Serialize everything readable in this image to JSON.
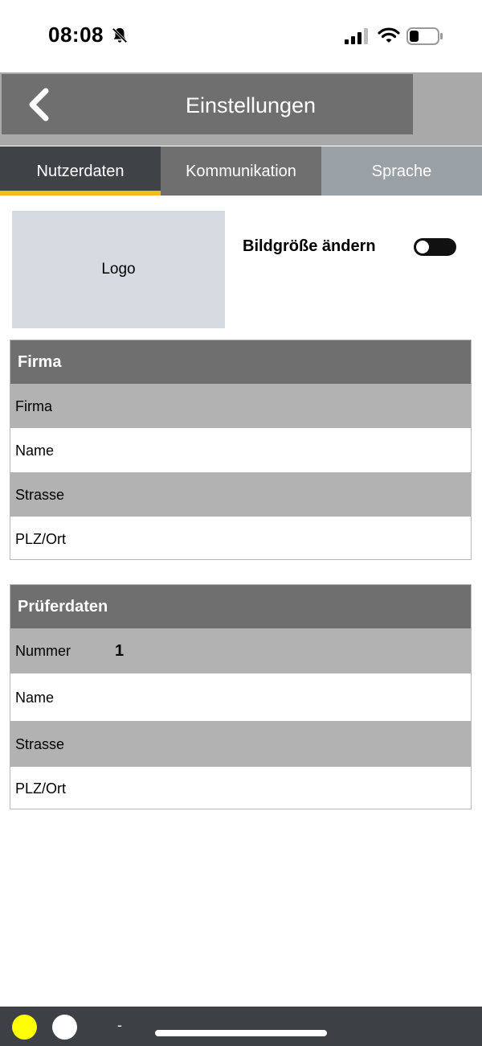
{
  "status_bar": {
    "time": "08:08",
    "icons": [
      "bell-slash-icon",
      "cellular-signal-icon",
      "wifi-icon",
      "battery-icon"
    ]
  },
  "header": {
    "title": "Einstellungen",
    "back_icon": "chevron-left-icon"
  },
  "tabs": [
    {
      "label": "Nutzerdaten",
      "active": true
    },
    {
      "label": "Kommunikation",
      "active": false
    },
    {
      "label": "Sprache",
      "active": false
    }
  ],
  "logo": {
    "label": "Logo"
  },
  "image_resize": {
    "label": "Bildgröße ändern",
    "enabled": false
  },
  "company_section": {
    "title": "Firma",
    "rows": [
      {
        "label": "Firma",
        "value": ""
      },
      {
        "label": "Name",
        "value": ""
      },
      {
        "label": "Strasse",
        "value": ""
      },
      {
        "label": "PLZ/Ort",
        "value": ""
      }
    ]
  },
  "inspector_section": {
    "title": "Prüferdaten",
    "rows": [
      {
        "label": "Nummer",
        "value": "1"
      },
      {
        "label": "Name",
        "value": ""
      },
      {
        "label": "Strasse",
        "value": ""
      },
      {
        "label": "PLZ/Ort",
        "value": ""
      }
    ]
  },
  "bottom_bar": {
    "dash": "-"
  },
  "colors": {
    "header_bg": "#6f6f6f",
    "active_tab_bg": "#3f4347",
    "active_tab_underline": "#f6bd1a",
    "section_header_bg": "#6f6f6f",
    "row_gray_bg": "#b2b2b2",
    "logo_bg": "#d5dbe1",
    "bottom_bar_bg": "#3d4044",
    "yellow_dot": "#ffff00"
  }
}
